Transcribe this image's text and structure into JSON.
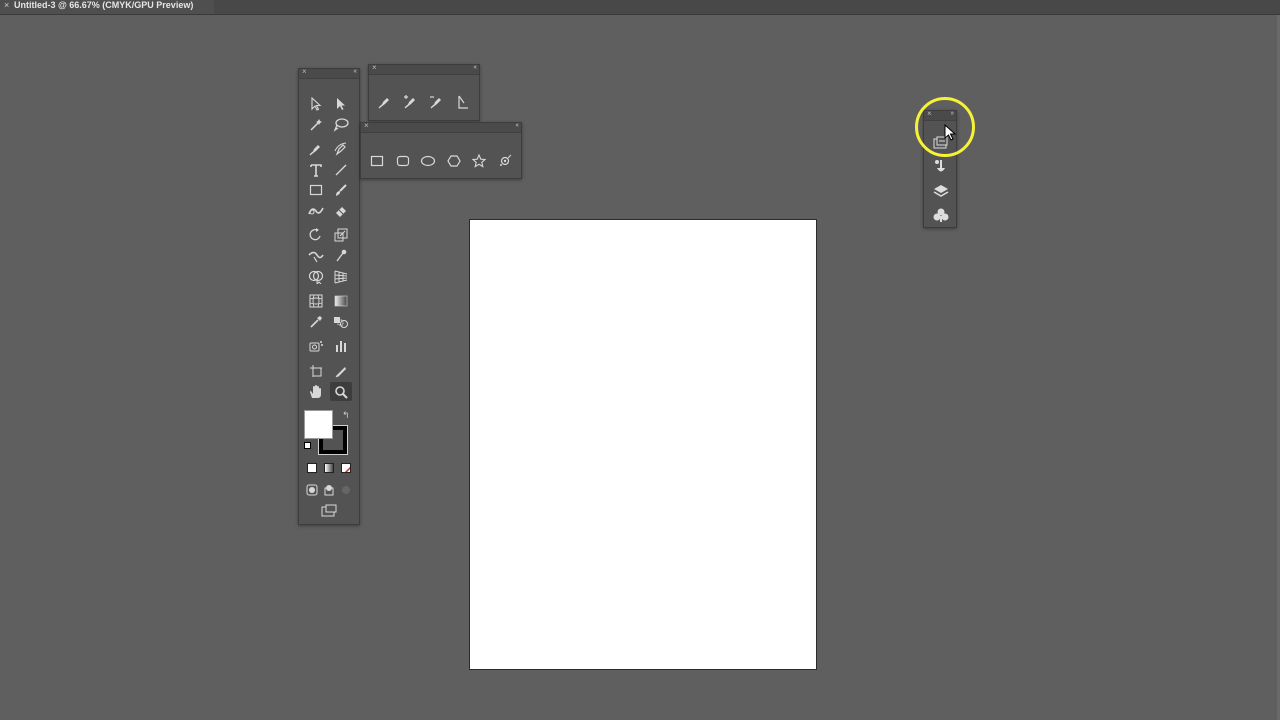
{
  "document_tab": {
    "close_glyph": "×",
    "title": "Untitled-3 @ 66.67% (CMYK/GPU Preview)"
  },
  "toolbar": {
    "tools": [
      "selection-tool",
      "direct-selection-tool",
      "magic-wand-tool",
      "lasso-tool",
      "pen-tool",
      "curvature-tool",
      "type-tool",
      "line-segment-tool",
      "rectangle-tool",
      "paintbrush-tool",
      "shaper-tool",
      "eraser-tool",
      "rotate-tool",
      "scale-tool",
      "width-tool",
      "puppet-warp-tool",
      "shape-builder-tool",
      "perspective-grid-tool",
      "mesh-tool",
      "gradient-tool",
      "eyedropper-tool",
      "blend-tool",
      "symbol-sprayer-tool",
      "column-graph-tool",
      "artboard-tool",
      "slice-tool",
      "hand-tool",
      "zoom-tool"
    ],
    "active_tool": "zoom-tool",
    "fill_color": "#ffffff",
    "stroke_color": "#000000"
  },
  "pen_flyout": {
    "tools": [
      "pen-tool",
      "add-anchor-point-tool",
      "delete-anchor-point-tool",
      "anchor-point-tool"
    ]
  },
  "shape_flyout": {
    "tools": [
      "rectangle-tool",
      "rounded-rectangle-tool",
      "ellipse-tool",
      "polygon-tool",
      "star-tool",
      "flare-tool"
    ]
  },
  "collapsed_panel_dock": {
    "icons": [
      "libraries-icon",
      "brushes-icon",
      "layers-icon",
      "symbols-icon"
    ]
  },
  "canvas": {
    "background": "#5f5f5f",
    "artboard_color": "#ffffff"
  }
}
